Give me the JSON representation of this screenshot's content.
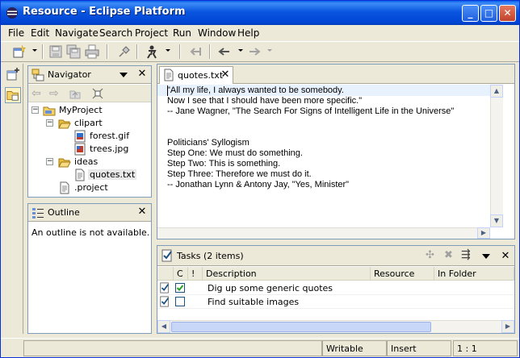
{
  "window": {
    "title": "Resource - Eclipse Platform"
  },
  "menu": [
    "File",
    "Edit",
    "Navigate",
    "Search",
    "Project",
    "Run",
    "Window",
    "Help"
  ],
  "navigator": {
    "title": "Navigator",
    "tree": [
      {
        "label": "MyProject"
      },
      {
        "label": "clipart"
      },
      {
        "label": "forest.gif"
      },
      {
        "label": "trees.jpg"
      },
      {
        "label": "ideas"
      },
      {
        "label": "quotes.txt"
      },
      {
        "label": ".project"
      }
    ]
  },
  "outline": {
    "title": "Outline",
    "message": "An outline is not available."
  },
  "editor": {
    "tab": "quotes.txt",
    "lines": [
      "\"All my life, I always wanted to be somebody.",
      "Now I see that I should have been more specific.\"",
      "-- Jane Wagner, \"The Search For Signs of Intelligent Life in the Universe\"",
      "",
      "",
      "Politicians' Syllogism",
      "Step One: We must do something.",
      "Step Two: This is something.",
      "Step Three: Therefore we must do it.",
      "-- Jonathan Lynn & Antony Jay, \"Yes, Minister\""
    ]
  },
  "tasks": {
    "title": "Tasks (2 items)",
    "columns": [
      "C",
      "!",
      "Description",
      "Resource",
      "In Folder"
    ],
    "rows": [
      {
        "checked": true,
        "description": "Dig up some generic quotes"
      },
      {
        "checked": false,
        "description": "Find suitable images"
      }
    ]
  },
  "status": {
    "mode": "Writable",
    "insert": "Insert",
    "position": "1 : 1"
  },
  "colors": {
    "titlebar": "#0054e3",
    "selection": "#e8f2fe",
    "folder": "#f4d36b"
  }
}
